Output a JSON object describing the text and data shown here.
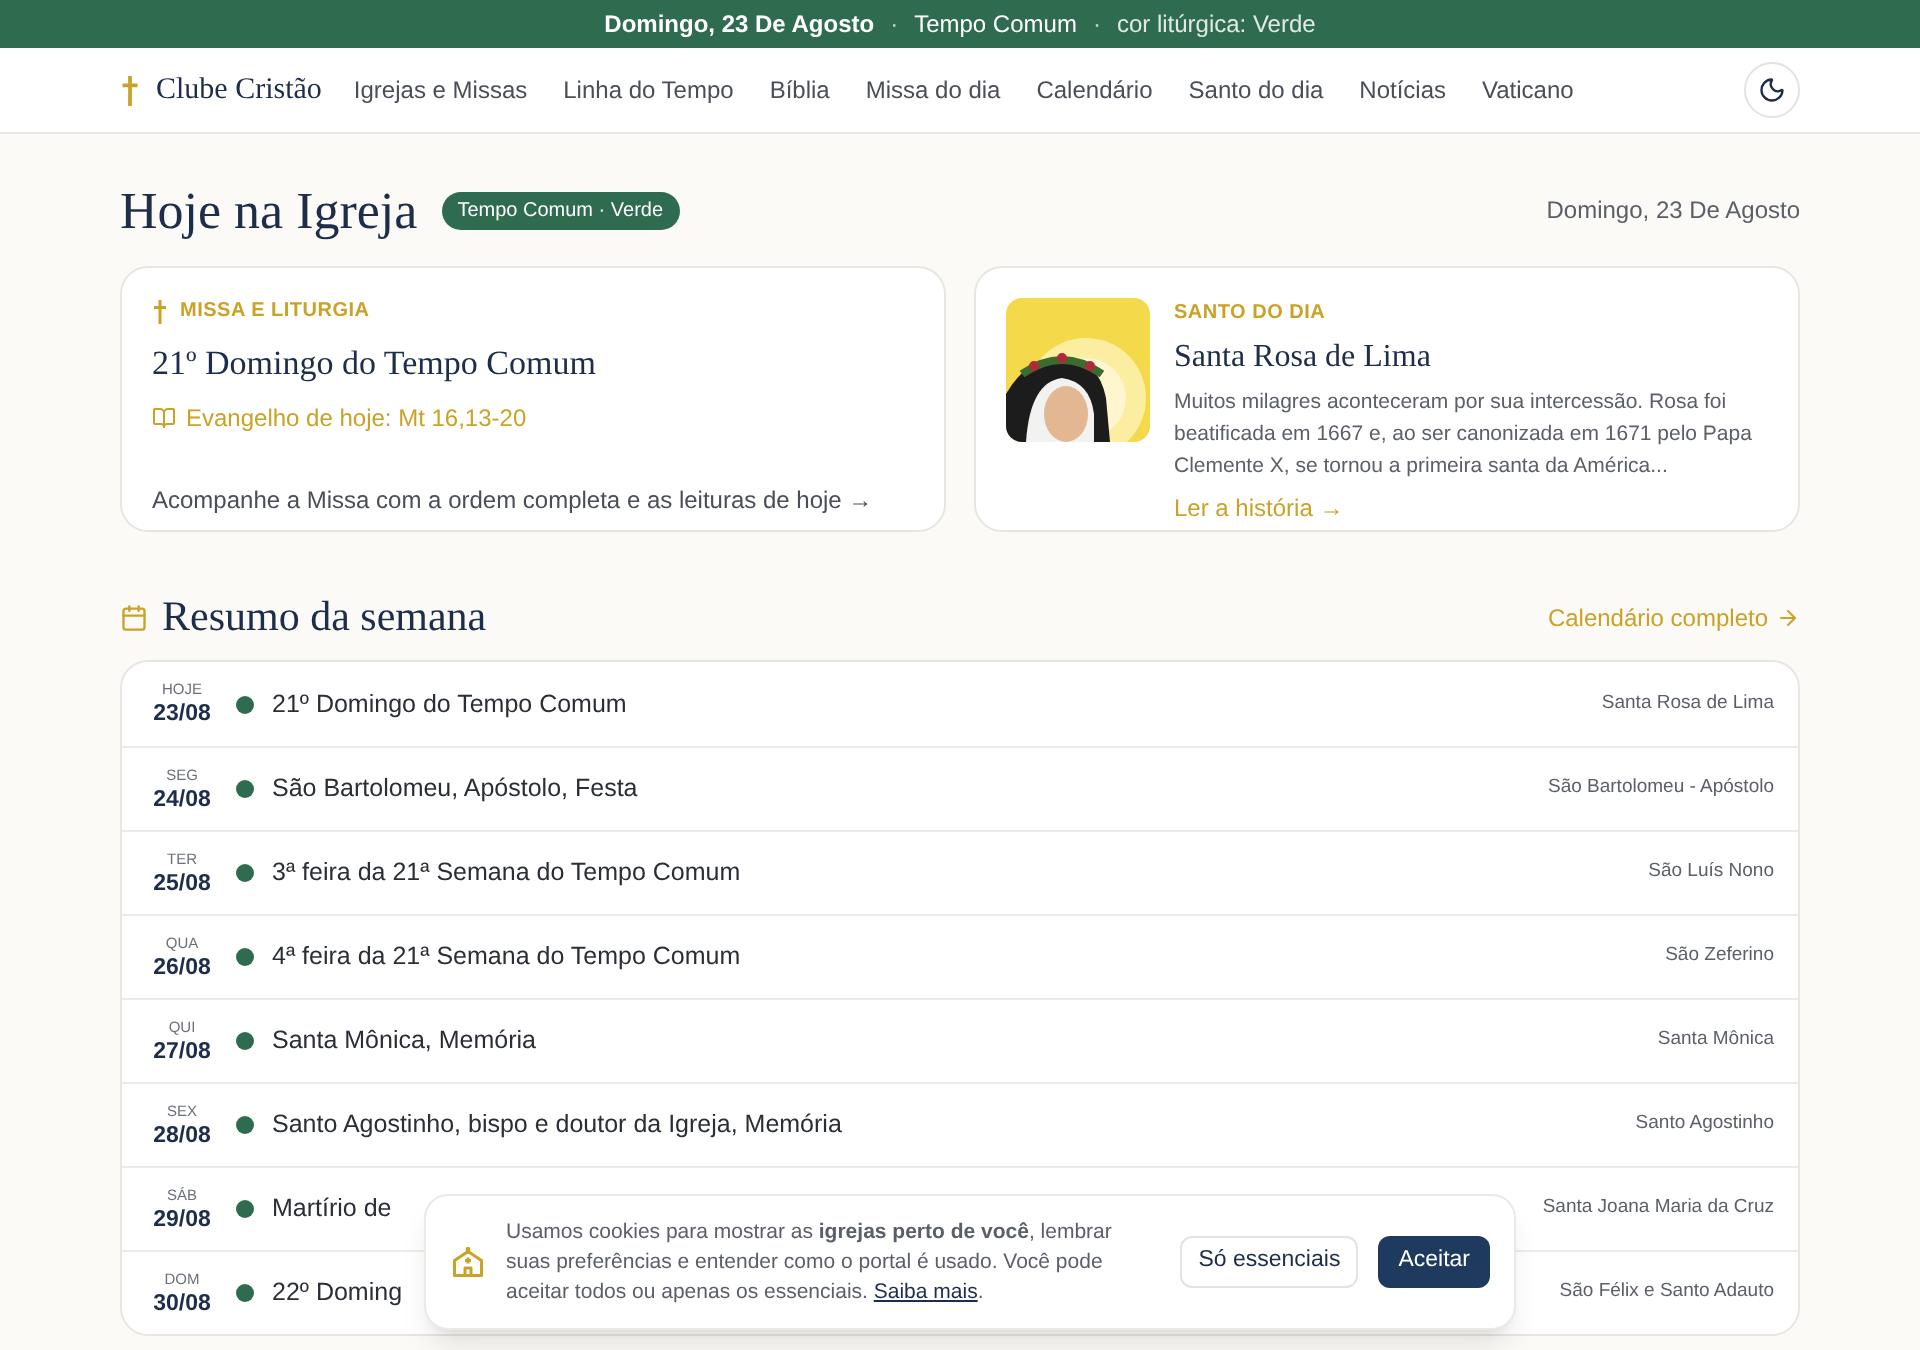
{
  "top_bar": {
    "date": "Domingo, 23 De Agosto",
    "season": "Tempo Comum",
    "color_label": "cor litúrgica: Verde",
    "separator": "·"
  },
  "nav": {
    "logo": "Clube Cristão",
    "items": [
      "Igrejas e Missas",
      "Linha do Tempo",
      "Bíblia",
      "Missa do dia",
      "Calendário",
      "Santo do dia",
      "Notícias",
      "Vaticano"
    ]
  },
  "header": {
    "title": "Hoje na Igreja",
    "badge": "Tempo Comum · Verde",
    "date": "Domingo, 23 De Agosto"
  },
  "mass_card": {
    "eyebrow": "MISSA E LITURGIA",
    "title": "21º Domingo do Tempo Comum",
    "gospel": "Evangelho de hoje: Mt 16,13-20",
    "link": "Acompanhe a Missa com a ordem completa e as leituras de hoje →"
  },
  "saint_card": {
    "eyebrow": "SANTO DO DIA",
    "title": "Santa Rosa de Lima",
    "text": "Muitos milagres aconteceram por sua intercessão. Rosa foi beatificada em 1667 e, ao ser canonizada em 1671 pelo Papa Clemente X, se tornou a primeira santa da América...",
    "link": "Ler a história →"
  },
  "week": {
    "title": "Resumo da semana",
    "link": "Calendário completo",
    "rows": [
      {
        "day": "HOJE",
        "date": "23/08",
        "color": "#2f6b4f",
        "title": "21º Domingo do Tempo Comum",
        "saint": "Santa Rosa de Lima"
      },
      {
        "day": "SEG",
        "date": "24/08",
        "color": "#2f6b4f",
        "title": "São Bartolomeu, Apóstolo, Festa",
        "saint": "São Bartolomeu - Apóstolo"
      },
      {
        "day": "TER",
        "date": "25/08",
        "color": "#2f6b4f",
        "title": "3ª feira da 21ª Semana do Tempo Comum",
        "saint": "São Luís Nono"
      },
      {
        "day": "QUA",
        "date": "26/08",
        "color": "#2f6b4f",
        "title": "4ª feira da 21ª Semana do Tempo Comum",
        "saint": "São Zeferino"
      },
      {
        "day": "QUI",
        "date": "27/08",
        "color": "#2f6b4f",
        "title": "Santa Mônica, Memória",
        "saint": "Santa Mônica"
      },
      {
        "day": "SEX",
        "date": "28/08",
        "color": "#2f6b4f",
        "title": "Santo Agostinho, bispo e doutor da Igreja, Memória",
        "saint": "Santo Agostinho"
      },
      {
        "day": "SÁB",
        "date": "29/08",
        "color": "#2f6b4f",
        "title": "Martírio de",
        "saint": "Santa Joana Maria da Cruz"
      },
      {
        "day": "DOM",
        "date": "30/08",
        "color": "#2f6b4f",
        "title": "22º Doming",
        "saint": "São Félix e Santo Adauto"
      }
    ]
  },
  "cookie": {
    "text": "Usamos cookies para mostrar as **igrejas perto de você**, lembrar suas preferências e entender como o portal é usado. Você pode aceitar todos ou apenas os essenciais.",
    "link": "Saiba mais",
    "after_link": ".",
    "buttons": [
      "Só essenciais",
      "Aceitar"
    ]
  }
}
